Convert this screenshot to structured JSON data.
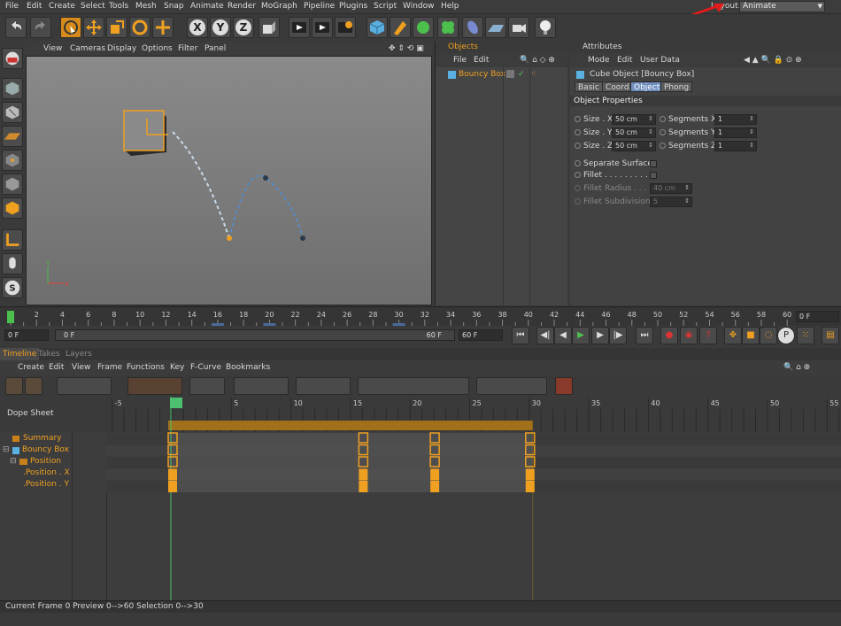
{
  "menu": [
    "File",
    "Edit",
    "Create",
    "Select",
    "Tools",
    "Mesh",
    "Snap",
    "Animate",
    "Render",
    "MoGraph",
    "Pipeline",
    "Plugins",
    "Script",
    "Window",
    "Help"
  ],
  "layout": {
    "label": "Layout:",
    "value": "Animate"
  },
  "viewport": {
    "menu": [
      "View",
      "Cameras",
      "Display",
      "Options",
      "Filter",
      "Panel"
    ]
  },
  "objects": {
    "title": "Objects",
    "menu": [
      "File",
      "Edit"
    ],
    "item": "Bouncy Box"
  },
  "attributes": {
    "title": "Attributes",
    "menu": [
      "Mode",
      "Edit",
      "User Data"
    ],
    "object_name": "Cube Object [Bouncy Box]",
    "tabs": [
      "Basic",
      "Coord.",
      "Object",
      "Phong"
    ],
    "active_tab": "Object",
    "section": "Object Properties",
    "size_x_label": "Size . X",
    "size_x": "50 cm",
    "size_y_label": "Size . Y",
    "size_y": "50 cm",
    "size_z_label": "Size . Z",
    "size_z": "50 cm",
    "seg_x_label": "Segments X",
    "seg_x": "1",
    "seg_y_label": "Segments Y",
    "seg_y": "1",
    "seg_z_label": "Segments Z",
    "seg_z": "1",
    "separate_surfaces": "Separate Surfaces",
    "fillet": "Fillet . . . . . . . . . . .",
    "fillet_radius_label": "Fillet Radius . . . .",
    "fillet_radius": "40 cm",
    "fillet_subdiv_label": "Fillet Subdivision",
    "fillet_subdiv": "5"
  },
  "ruler": {
    "ticks": [
      "0",
      "2",
      "4",
      "6",
      "8",
      "10",
      "12",
      "14",
      "16",
      "18",
      "20",
      "22",
      "24",
      "26",
      "28",
      "30",
      "32",
      "34",
      "36",
      "38",
      "40",
      "42",
      "44",
      "46",
      "48",
      "50",
      "52",
      "54",
      "56",
      "58",
      "60"
    ],
    "current": "0 F"
  },
  "frames": {
    "start": "0 F",
    "range_start": "0 F",
    "range_end": "60 F",
    "end": "60 F"
  },
  "timeline_tabs": [
    "Timeline",
    "Takes",
    "Layers"
  ],
  "timeline_menu": [
    "Create",
    "Edit",
    "View",
    "Frame",
    "Functions",
    "Key",
    "F-Curve",
    "Bookmarks"
  ],
  "dopesheet": {
    "label": "Dope Sheet",
    "ticks": [
      "-5",
      "0",
      "5",
      "10",
      "15",
      "20",
      "25",
      "30",
      "35",
      "40",
      "45",
      "50",
      "55"
    ],
    "rows": [
      "Summary",
      "Bouncy Box",
      "Position",
      ".Position . X",
      ".Position . Y"
    ]
  },
  "status": "Current Frame  0  Preview  0-->60   Selection 0-->30"
}
